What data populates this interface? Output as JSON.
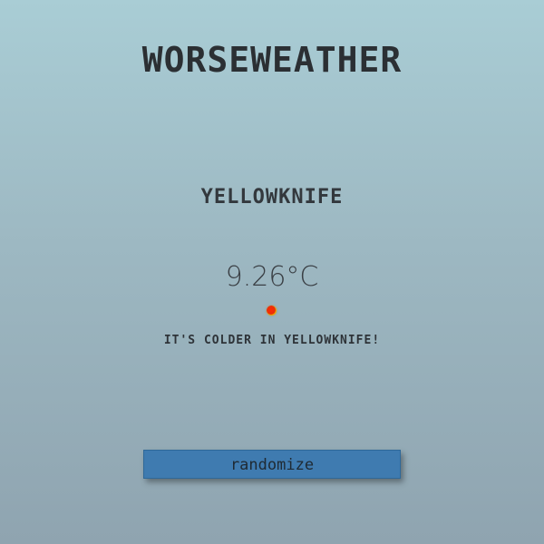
{
  "header": {
    "logo_text": "WORSEWEATHER"
  },
  "weather": {
    "city": "YELLOWKNIFE",
    "temperature": "9.26°C",
    "message": "IT'S COLDER IN YELLOWKNIFE!"
  },
  "actions": {
    "randomize_label": "randomize"
  },
  "colors": {
    "button": "#3f7bb0",
    "marker": "#ff2a00"
  }
}
